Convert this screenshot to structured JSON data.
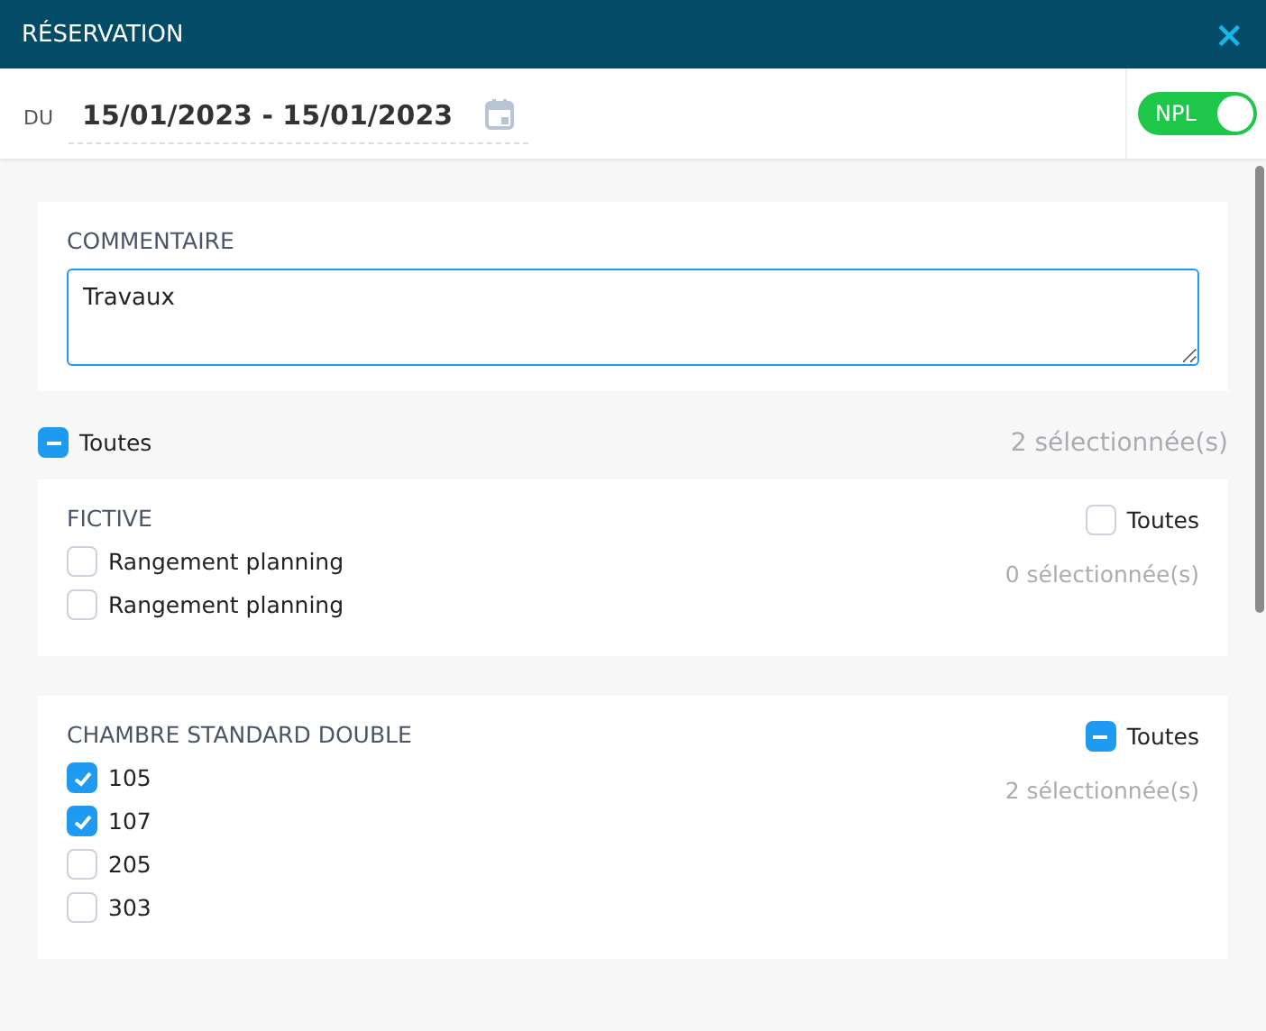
{
  "window": {
    "title": "RÉSERVATION",
    "close": "×"
  },
  "date_bar": {
    "label": "DU",
    "value": "15/01/2023 - 15/01/2023",
    "toggle": {
      "label": "NPL",
      "on": true
    }
  },
  "comment": {
    "label": "COMMENTAIRE",
    "value": "Travaux"
  },
  "select_all": {
    "label": "Toutes",
    "partial": true,
    "count": "2 sélectionnée(s)"
  },
  "groups": [
    {
      "title": "FICTIVE",
      "all": {
        "label": "Toutes",
        "partial": false
      },
      "count": "0 sélectionnée(s)",
      "items": [
        {
          "label": "Rangement planning",
          "checked": false
        },
        {
          "label": "Rangement planning",
          "checked": false
        }
      ]
    },
    {
      "title": "CHAMBRE STANDARD DOUBLE",
      "all": {
        "label": "Toutes",
        "partial": true
      },
      "count": "2 sélectionnée(s)",
      "items": [
        {
          "label": "105",
          "checked": true
        },
        {
          "label": "107",
          "checked": true
        },
        {
          "label": "205",
          "checked": false
        },
        {
          "label": "303",
          "checked": false
        }
      ]
    }
  ]
}
